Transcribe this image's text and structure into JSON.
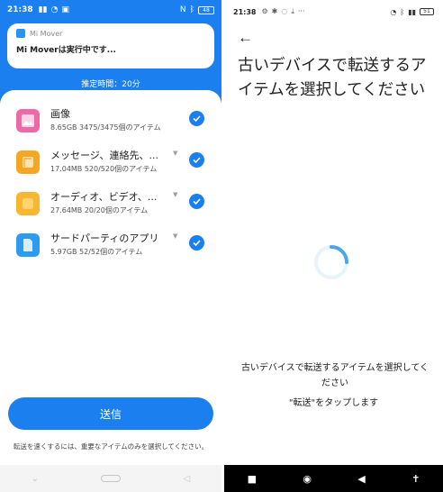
{
  "left": {
    "status": {
      "time": "21:38",
      "battery": "48"
    },
    "notification": {
      "app_name": "Mi Mover",
      "title": "Mi Moverは実行中です..."
    },
    "estimate": "推定時間：20分",
    "items": [
      {
        "name": "画像",
        "detail": "8.65GB  3475/3475個のアイテム",
        "icon": "image-icon",
        "color": "#ec6ba7",
        "expandable": false
      },
      {
        "name": "メッセージ、連絡先、...",
        "detail": "17.04MB  520/520個のアイテム",
        "icon": "message-icon",
        "color": "#f5a623",
        "expandable": true
      },
      {
        "name": "オーディオ、ビデオ、...",
        "detail": "27.64MB  20/20個のアイテム",
        "icon": "folder-icon",
        "color": "#f7b731",
        "expandable": true
      },
      {
        "name": "サードパーティのアプリ",
        "detail": "5.97GB  52/52個のアイテム",
        "icon": "app-file-icon",
        "color": "#2d9cf0",
        "expandable": true
      }
    ],
    "send_label": "送信",
    "hint": "転送を速くするには、重要なアイテムのみを選択してください。"
  },
  "right": {
    "status": {
      "time": "21:38",
      "battery": "51"
    },
    "title": "古いデバイスで転送するアイテムを選択してください",
    "message": "古いデバイスで転送するアイテムを選択してください",
    "tap_hint": "\"転送\"をタップします"
  },
  "colors": {
    "accent": "#1b7ff0",
    "nav_dark": "#000000"
  }
}
